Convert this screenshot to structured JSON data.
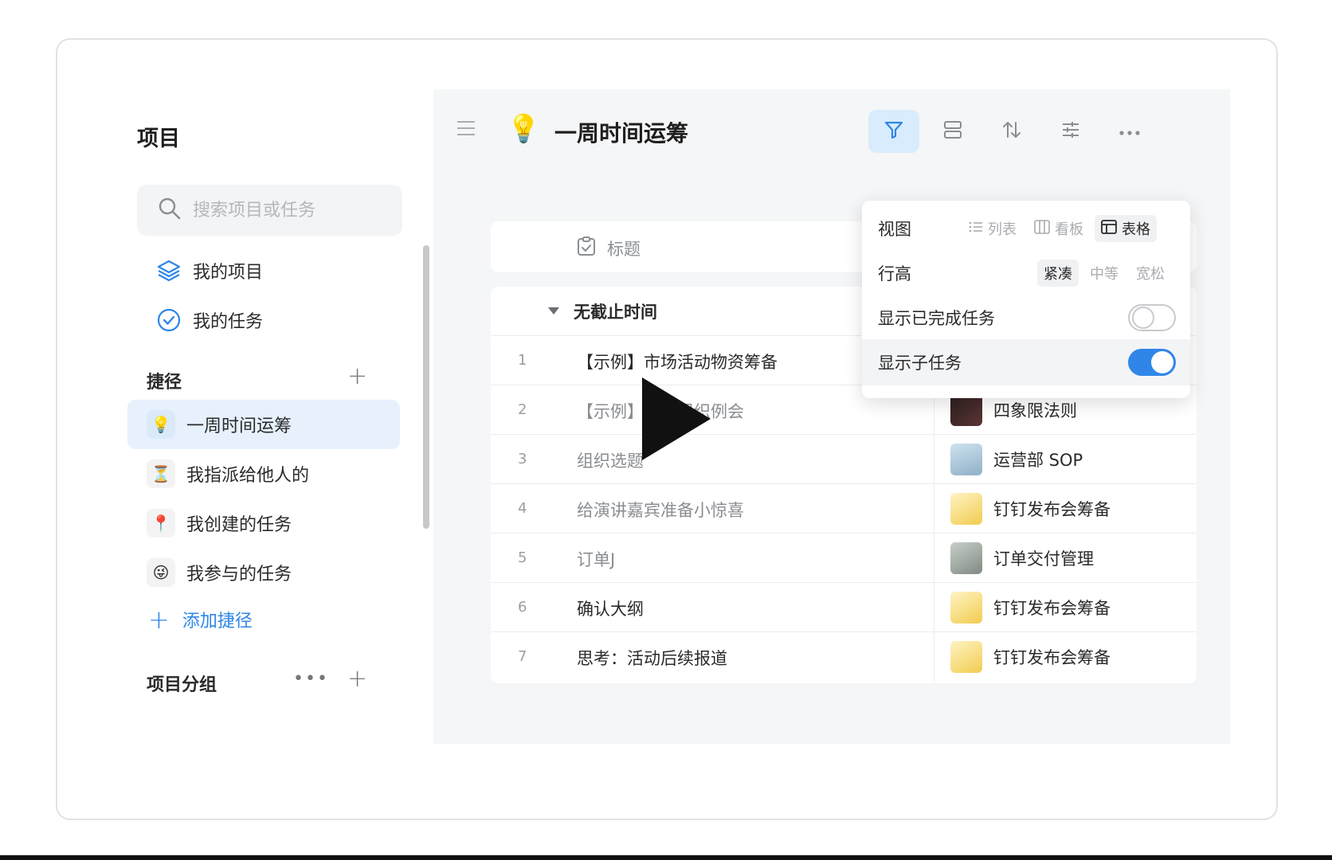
{
  "sidebar": {
    "title": "项目",
    "search_placeholder": "搜索项目或任务",
    "nav": [
      {
        "label": "我的项目",
        "icon": "layers-icon"
      },
      {
        "label": "我的任务",
        "icon": "check-circle-icon"
      }
    ],
    "shortcuts_title": "捷径",
    "shortcuts": [
      {
        "label": "一周时间运筹",
        "icon": "💡"
      },
      {
        "label": "我指派给他人的",
        "icon": "⏳"
      },
      {
        "label": "我创建的任务",
        "icon": "📍"
      },
      {
        "label": "我参与的任务",
        "icon": "😜"
      }
    ],
    "add_shortcut": "添加捷径",
    "groups_title": "项目分组"
  },
  "main": {
    "page_icon": "💡",
    "title": "一周时间运筹",
    "header_column": "标题",
    "group": "无截止时间",
    "rows": [
      {
        "num": "1",
        "title": "【示例】市场活动物资筹备",
        "dim": false,
        "project": "",
        "thumb": ""
      },
      {
        "num": "2",
        "title": "【示例】每周组织例会",
        "dim": true,
        "project": "四象限法则",
        "thumb": "#3a2a2a"
      },
      {
        "num": "3",
        "title": "组织选题",
        "dim": true,
        "project": "运营部 SOP",
        "thumb": "#b9d3e6"
      },
      {
        "num": "4",
        "title": "给演讲嘉宾准备小惊喜",
        "dim": true,
        "project": "钉钉发布会筹备",
        "thumb": "#f5d66a"
      },
      {
        "num": "5",
        "title": "订单J",
        "dim": true,
        "project": "订单交付管理",
        "thumb": "#9fa7a1"
      },
      {
        "num": "6",
        "title": "确认大纲",
        "dim": false,
        "project": "钉钉发布会筹备",
        "thumb": "#f5d66a"
      },
      {
        "num": "7",
        "title": "思考：活动后续报道",
        "dim": false,
        "project": "钉钉发布会筹备",
        "thumb": "#f5d66a"
      }
    ]
  },
  "popover": {
    "view_label": "视图",
    "view_options": [
      "列表",
      "看板",
      "表格"
    ],
    "view_selected": "表格",
    "row_height_label": "行高",
    "row_height_options": [
      "紧凑",
      "中等",
      "宽松"
    ],
    "row_height_selected": "紧凑",
    "show_completed_label": "显示已完成任务",
    "show_completed": false,
    "show_subtasks_label": "显示子任务",
    "show_subtasks": true
  },
  "colors": {
    "accent": "#2f86e8",
    "active_bg": "#e6f1fd"
  }
}
